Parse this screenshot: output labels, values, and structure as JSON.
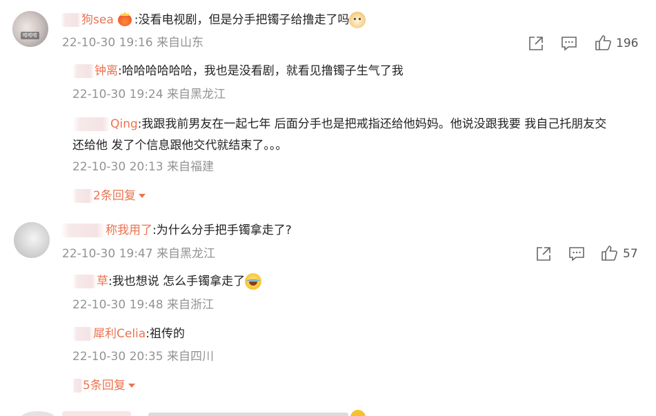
{
  "comments": [
    {
      "username": "狗sea",
      "text": ":没看电视剧，但是分手把镯子给撸走了吗",
      "time_location": "22-10-30 19:16 来自山东",
      "likes": "196",
      "avatar_tag": "哈哈哈",
      "replies": [
        {
          "username": "钟离",
          "text": ":哈哈哈哈哈哈，我也是没看剧，就看见撸镯子生气了我",
          "time_location": "22-10-30 19:24 来自黑龙江"
        },
        {
          "username": "Qing",
          "text_line1": ":我跟我前男友在一起七年 后面分手也是把戒指还给他妈妈。他说没跟我要 我自己托朋友交",
          "text_line2": "还给他 发了个信息跟他交代就结束了。。。",
          "time_location": "22-10-30 20:13 来自福建"
        }
      ],
      "more_replies": "2条回复"
    },
    {
      "username": "称我用了",
      "text": ":为什么分手把手镯拿走了?",
      "time_location": "22-10-30 19:47 来自黑龙江",
      "likes": "57",
      "replies": [
        {
          "username": "草",
          "text": ":我也想说 怎么手镯拿走了",
          "time_location": "22-10-30 19:48 来自浙江"
        },
        {
          "username": "犀利Celia",
          "text": ":祖传的",
          "time_location": "22-10-30 20:35 来自四川"
        }
      ],
      "more_replies": "5条回复"
    }
  ],
  "icons": {
    "share": "share-icon",
    "comment": "comment-icon",
    "like": "thumbs-up-icon"
  },
  "colors": {
    "username": "#eb7350",
    "meta": "#939393",
    "text": "#222222"
  }
}
